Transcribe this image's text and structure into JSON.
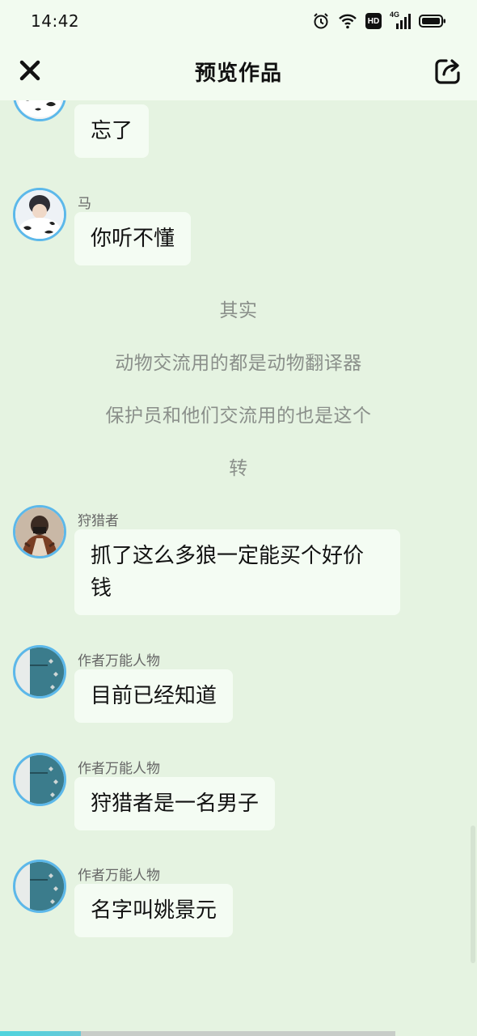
{
  "status": {
    "time": "14:42",
    "hd_label": "HD",
    "network_label": "4G"
  },
  "nav": {
    "title": "预览作品"
  },
  "messages": [
    {
      "sender": "",
      "text": "忘了"
    },
    {
      "sender": "马",
      "text": "你听不懂"
    },
    {
      "sender": "狩猎者",
      "text": "抓了这么多狼一定能买个好价钱"
    },
    {
      "sender": "作者万能人物",
      "text": "目前已经知道"
    },
    {
      "sender": "作者万能人物",
      "text": "狩猎者是一名男子"
    },
    {
      "sender": "作者万能人物",
      "text": "名字叫姚景元"
    }
  ],
  "narration": [
    "其实",
    "动物交流用的都是动物翻译器",
    "保护员和他们交流用的也是这个",
    "转"
  ],
  "progress": {
    "played_fraction": 0.17,
    "buffered_fraction": 0.83
  },
  "colors": {
    "background": "#e5f3e1",
    "bubble": "#f4fcf3",
    "avatar_ring": "#5cb8ea",
    "progress": "#4fd4dd"
  }
}
